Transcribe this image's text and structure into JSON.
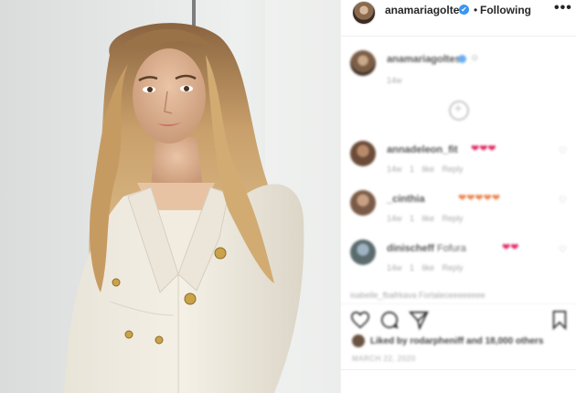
{
  "post": {
    "image": {
      "subject": "portrait-photo"
    }
  },
  "header": {
    "username": "anamariagoltes",
    "verified_icon": "✔",
    "separator": "•",
    "follow_label": "Following",
    "more_label": "•••"
  },
  "caption": {
    "username": "anamariagoltes",
    "emoji": "☺",
    "meta": "14w"
  },
  "comments": [
    {
      "username": "annadeleon_fit",
      "text": "",
      "hearts": "❤❤❤",
      "hearts_colors": [
        "#e0245e",
        "#e0245e",
        "#f5a623"
      ],
      "meta": "14w  1 like  Reply"
    },
    {
      "username": "_cinthia",
      "text": "",
      "hearts": "❤❤❤❤❤",
      "hearts_colors": [
        "#e0245e",
        "#f5a623",
        "#f5a623",
        "#e0245e",
        "#f5a623"
      ],
      "meta": "14w  1 like  Reply"
    },
    {
      "username": "dinischeff",
      "text": "Fofura",
      "hearts": "❤❤",
      "hearts_colors": [
        "#e0245e",
        "#e0245e"
      ],
      "meta": "14w  1 like  Reply"
    }
  ],
  "truncated_comment": "isabelle_fbafrkava Fortaleceeeeeeee",
  "likes": {
    "text": "Liked by rodarpheniff and 18,000 others"
  },
  "date": "MARCH 22, 2020",
  "colors": {
    "verified": "#3897f0",
    "divider": "#efefef",
    "text": "#262626"
  },
  "icons": [
    "heart-icon",
    "comment-icon",
    "share-icon",
    "bookmark-icon",
    "more-icon",
    "verified-icon",
    "load-more-icon"
  ]
}
